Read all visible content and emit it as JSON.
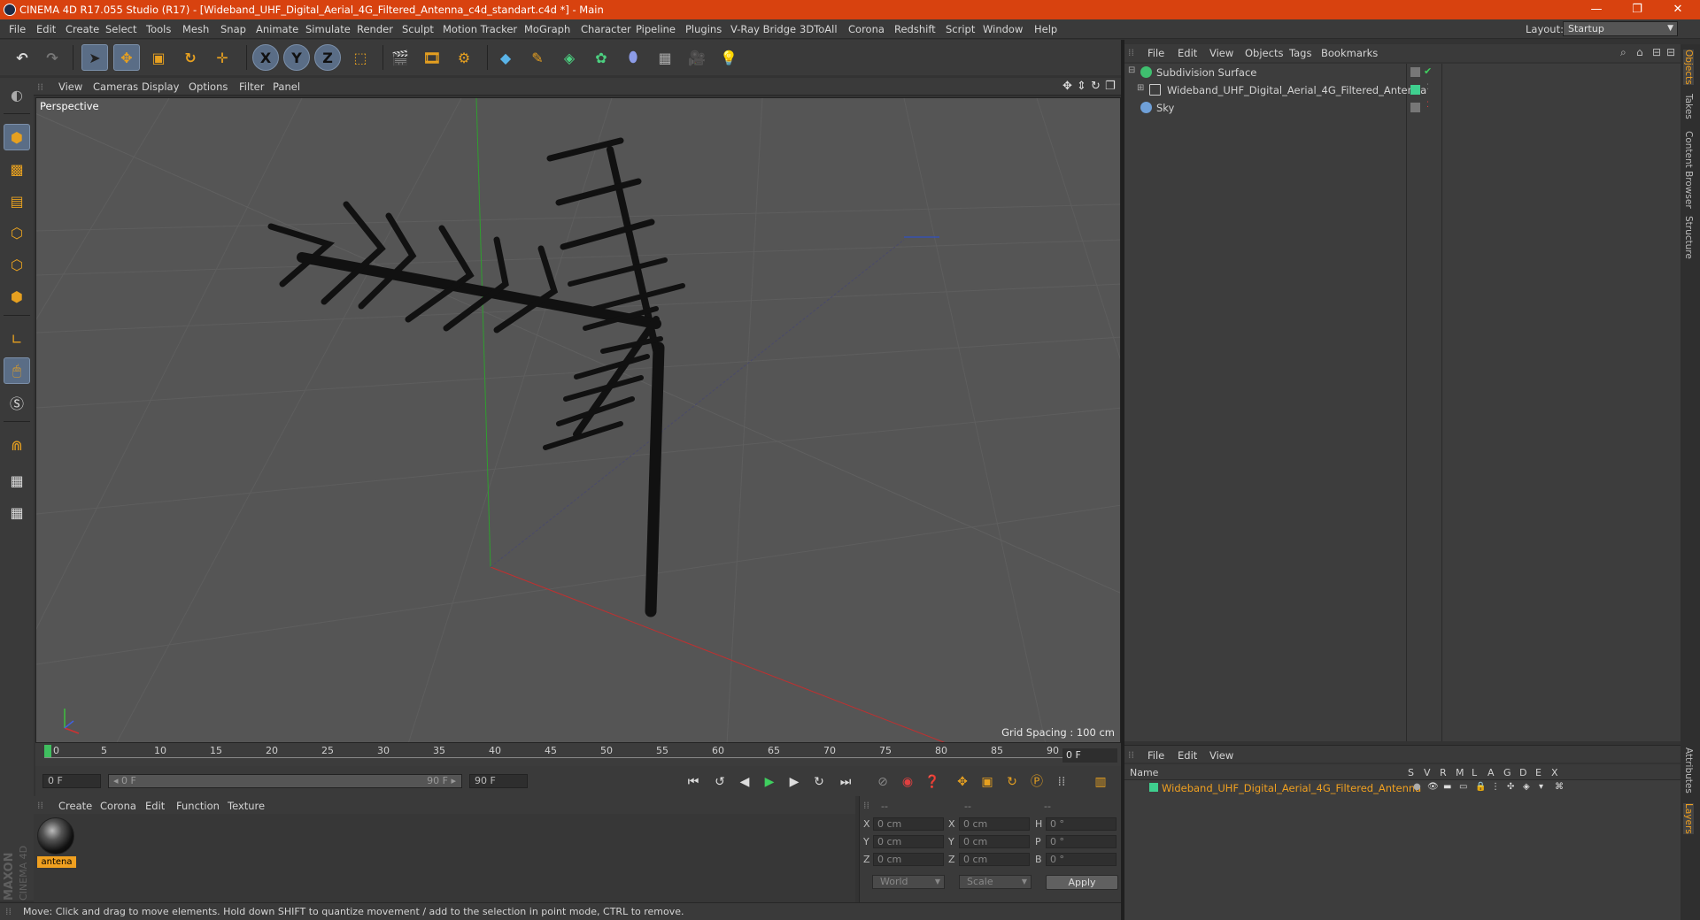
{
  "window": {
    "title": "CINEMA 4D R17.055 Studio (R17) - [Wideband_UHF_Digital_Aerial_4G_Filtered_Antenna_c4d_standart.c4d *] - Main",
    "minimize": "—",
    "maximize": "❐",
    "close": "✕"
  },
  "menubar": {
    "items": [
      "File",
      "Edit",
      "Create",
      "Select",
      "Tools",
      "Mesh",
      "Snap",
      "Animate",
      "Simulate",
      "Render",
      "Sculpt",
      "Motion Tracker",
      "MoGraph",
      "Character",
      "Pipeline",
      "Plugins",
      "V-Ray Bridge",
      "3DToAll",
      "Corona",
      "Redshift",
      "Script",
      "Window",
      "Help"
    ],
    "layout_label": "Layout:",
    "layout_value": "Startup"
  },
  "toolbar": {
    "x_axis": "X",
    "y_axis": "Y",
    "z_axis": "Z"
  },
  "viewport": {
    "menu": [
      "View",
      "Cameras",
      "Display",
      "Options",
      "Filter",
      "Panel"
    ],
    "label": "Perspective",
    "grid_spacing": "Grid Spacing : 100 cm"
  },
  "timeline": {
    "ticks": [
      "0",
      "5",
      "10",
      "15",
      "20",
      "25",
      "30",
      "35",
      "40",
      "45",
      "50",
      "55",
      "60",
      "65",
      "70",
      "75",
      "80",
      "85",
      "90"
    ],
    "current_frame": "0 F",
    "start_field": "0 F",
    "range_start": "◂ 0 F",
    "range_end": "90 F ▸",
    "end_field": "90 F"
  },
  "material_manager": {
    "menu": [
      "Create",
      "Corona",
      "Edit",
      "Function",
      "Texture"
    ],
    "materials": [
      {
        "name": "antena"
      }
    ]
  },
  "coordinates": {
    "header": [
      "--",
      "--",
      "--"
    ],
    "rows": [
      {
        "a_label": "X",
        "a_val": "0 cm",
        "b_label": "X",
        "b_val": "0 cm",
        "c_label": "H",
        "c_val": "0 °"
      },
      {
        "a_label": "Y",
        "a_val": "0 cm",
        "b_label": "Y",
        "b_val": "0 cm",
        "c_label": "P",
        "c_val": "0 °"
      },
      {
        "a_label": "Z",
        "a_val": "0 cm",
        "b_label": "Z",
        "b_val": "0 cm",
        "c_label": "B",
        "c_val": "0 °"
      }
    ],
    "world": "World",
    "scale": "Scale",
    "apply": "Apply"
  },
  "status_bar": {
    "text": "Move: Click and drag to move elements. Hold down SHIFT to quantize movement / add to the selection in point mode, CTRL to remove."
  },
  "object_manager": {
    "menu": [
      "File",
      "Edit",
      "View",
      "Objects",
      "Tags",
      "Bookmarks"
    ],
    "objects": [
      {
        "name": "Subdivision Surface",
        "indent": 0
      },
      {
        "name": "Wideband_UHF_Digital_Aerial_4G_Filtered_Antenna",
        "indent": 1
      },
      {
        "name": "Sky",
        "indent": 0
      }
    ]
  },
  "side_tabs": [
    "Objects",
    "Takes",
    "Content Browser",
    "Structure",
    "Attributes",
    "Layers"
  ],
  "layer_manager": {
    "menu": [
      "File",
      "Edit",
      "View"
    ],
    "columns": [
      "Name",
      "S",
      "V",
      "R",
      "M",
      "L",
      "A",
      "G",
      "D",
      "E",
      "X"
    ],
    "layers": [
      {
        "name": "Wideband_UHF_Digital_Aerial_4G_Filtered_Antenna"
      }
    ]
  },
  "branding": {
    "logo": "MAXON CINEMA 4D"
  },
  "colors": {
    "title_bar": "#d8420f",
    "accent": "#f0a020",
    "panel": "#3a3a3a",
    "viewport_bg": "#555555"
  }
}
